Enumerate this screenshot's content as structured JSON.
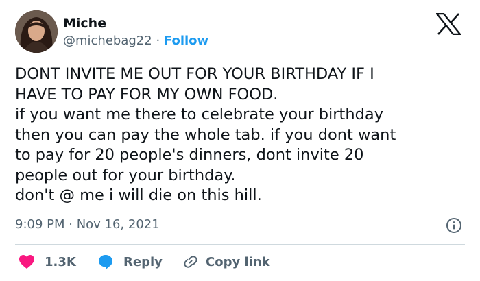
{
  "author": {
    "display_name": "Miche",
    "handle": "@michebag22",
    "separator": "·",
    "follow_label": "Follow"
  },
  "tweet": {
    "lines": [
      "DONT INVITE ME OUT FOR YOUR BIRTHDAY IF I",
      "HAVE TO PAY FOR MY OWN FOOD.",
      "if you want me there to celebrate your birthday",
      "then you can pay the whole tab. if you dont want",
      "to pay for 20 people's dinners, dont invite 20",
      "people out for your birthday.",
      "don't @ me i will die on this hill."
    ],
    "timestamp": "9:09 PM · Nov 16, 2021"
  },
  "actions": {
    "like_count": "1.3K",
    "reply_label": "Reply",
    "copy_link_label": "Copy link"
  },
  "colors": {
    "accent": "#1d9bf0",
    "like": "#f91880",
    "text": "#0f1419",
    "secondary": "#536471",
    "divider": "#cfd9de"
  },
  "icons": {
    "brand": "x-logo-icon",
    "info": "info-icon",
    "like": "heart-icon",
    "reply": "reply-bubble-icon",
    "copy": "link-icon"
  }
}
